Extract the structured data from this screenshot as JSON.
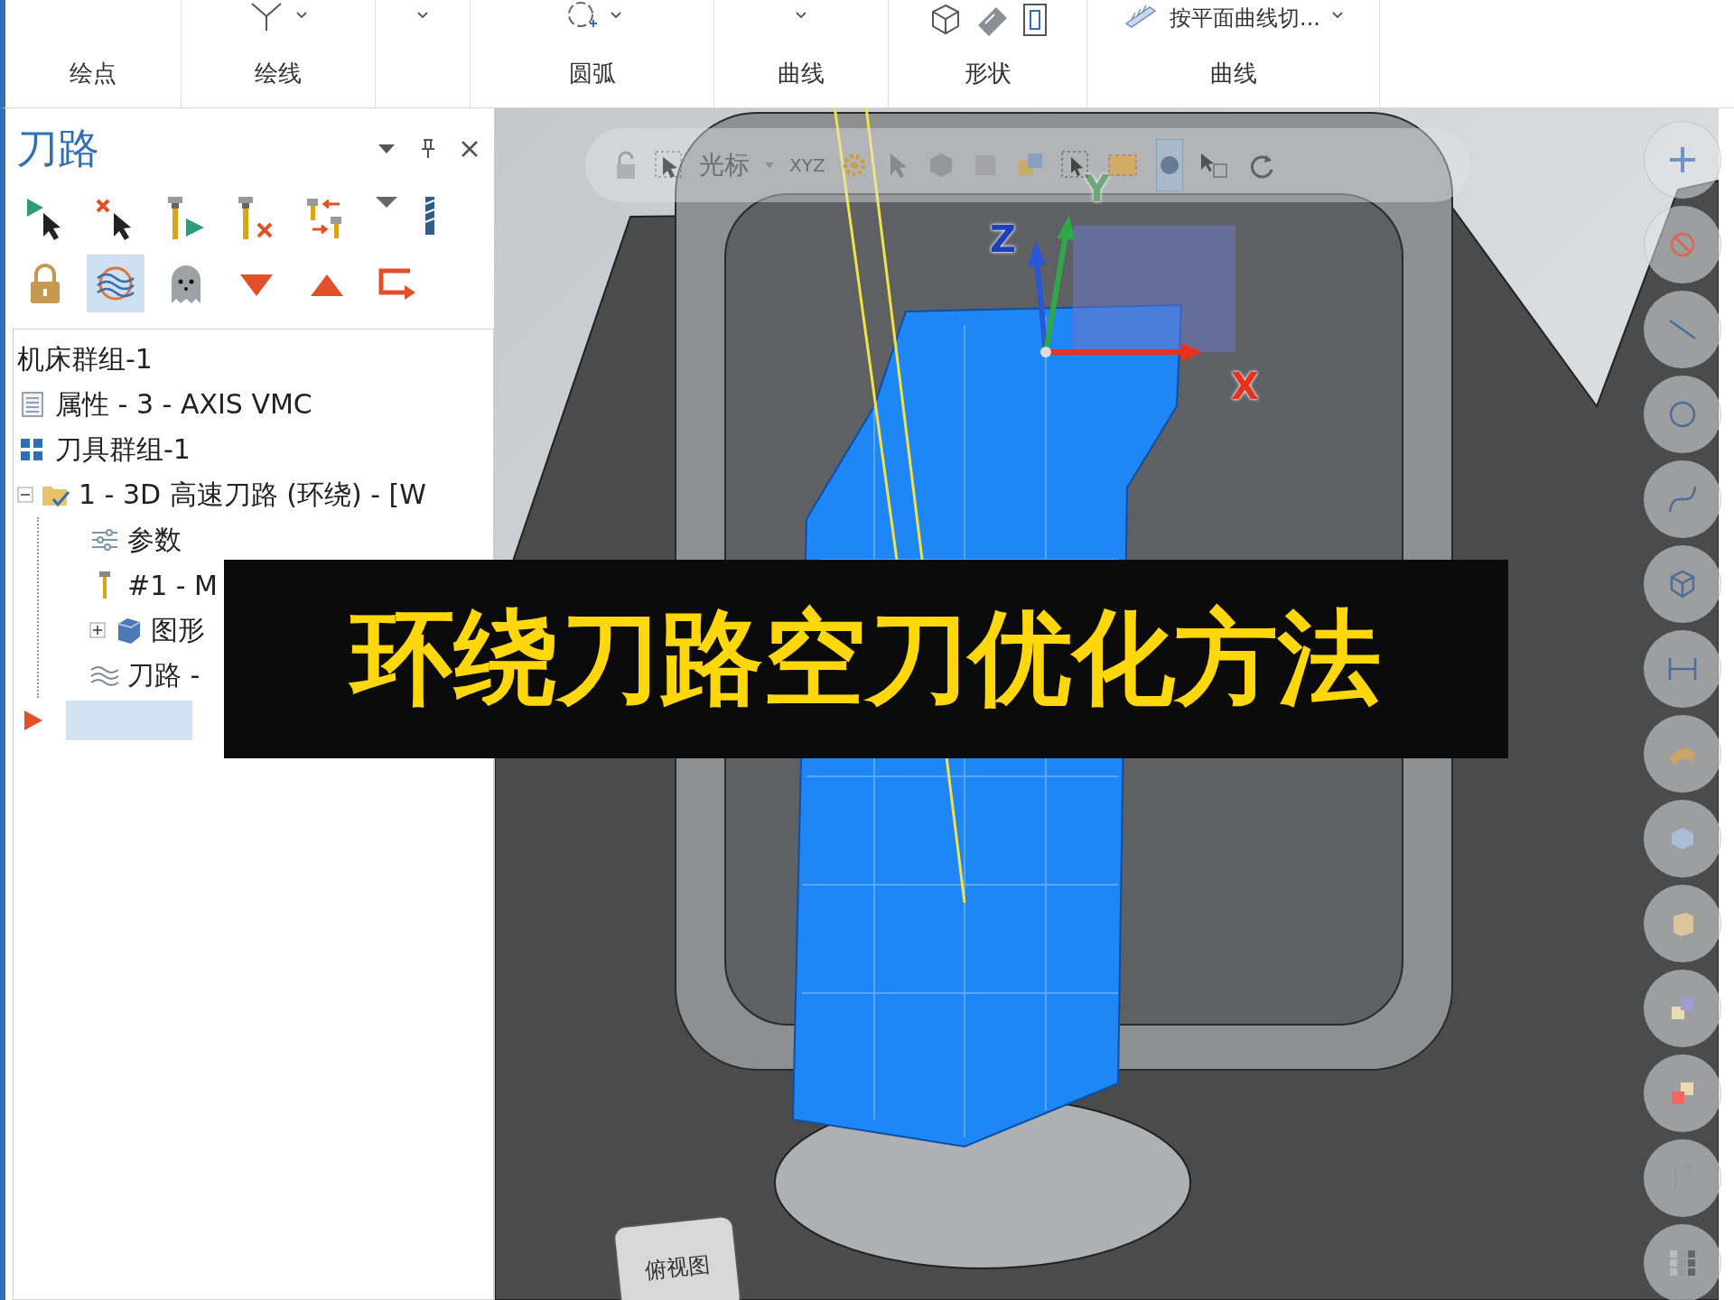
{
  "ribbon": {
    "groups": [
      {
        "kind": "points",
        "label": "绘点"
      },
      {
        "kind": "lines",
        "label": "绘线"
      },
      {
        "kind": "partial"
      },
      {
        "kind": "arcs",
        "label": "圆弧"
      },
      {
        "kind": "curves",
        "label": "曲线"
      },
      {
        "kind": "shapes",
        "label": "形状"
      },
      {
        "kind": "curve-cut",
        "label": "曲线",
        "button": "按平面曲线切..."
      }
    ]
  },
  "panel": {
    "title": "刀路",
    "toolbar": [
      [
        {
          "kind": "run-selected",
          "selected": false
        },
        {
          "kind": "deselect",
          "selected": false
        },
        {
          "kind": "tool-run",
          "selected": false
        },
        {
          "kind": "tool-delete",
          "selected": false
        },
        {
          "kind": "tool-swap",
          "selected": false
        },
        {
          "kind": "dropdown",
          "selected": false
        },
        {
          "kind": "tool-bit",
          "selected": false
        }
      ],
      [
        {
          "kind": "lock",
          "selected": false
        },
        {
          "kind": "toolpath-display",
          "selected": true
        },
        {
          "kind": "ghost",
          "selected": false
        },
        {
          "kind": "move-down",
          "selected": false
        },
        {
          "kind": "move-up",
          "selected": false
        },
        {
          "kind": "insert",
          "selected": false
        }
      ]
    ],
    "tree": [
      {
        "kind": "machine",
        "label": "机床群组-1"
      },
      {
        "kind": "properties",
        "label": "属性 - 3 - AXIS VMC"
      },
      {
        "kind": "group",
        "label": "刀具群组-1"
      },
      {
        "kind": "operation",
        "label": "1 - 3D 高速刀路 (环绕) - [W",
        "expanded": true,
        "children": [
          {
            "kind": "parameters",
            "label": "参数"
          },
          {
            "kind": "tool",
            "label": "#1 - M"
          },
          {
            "kind": "geometry",
            "label": "图形",
            "expanded": false
          },
          {
            "kind": "toolpath",
            "label": "刀路 -"
          }
        ]
      },
      {
        "kind": "insert-arrow",
        "selected": true
      }
    ]
  },
  "viewport": {
    "toolbar": {
      "label": "光标",
      "coords": "XYZ"
    },
    "axes": [
      {
        "kind": "x",
        "label": "X"
      },
      {
        "kind": "y",
        "label": "Y"
      },
      {
        "kind": "z",
        "label": "Z"
      }
    ],
    "view_cube": "俯视图"
  },
  "caption": "环绕刀路空刀优化方法"
}
